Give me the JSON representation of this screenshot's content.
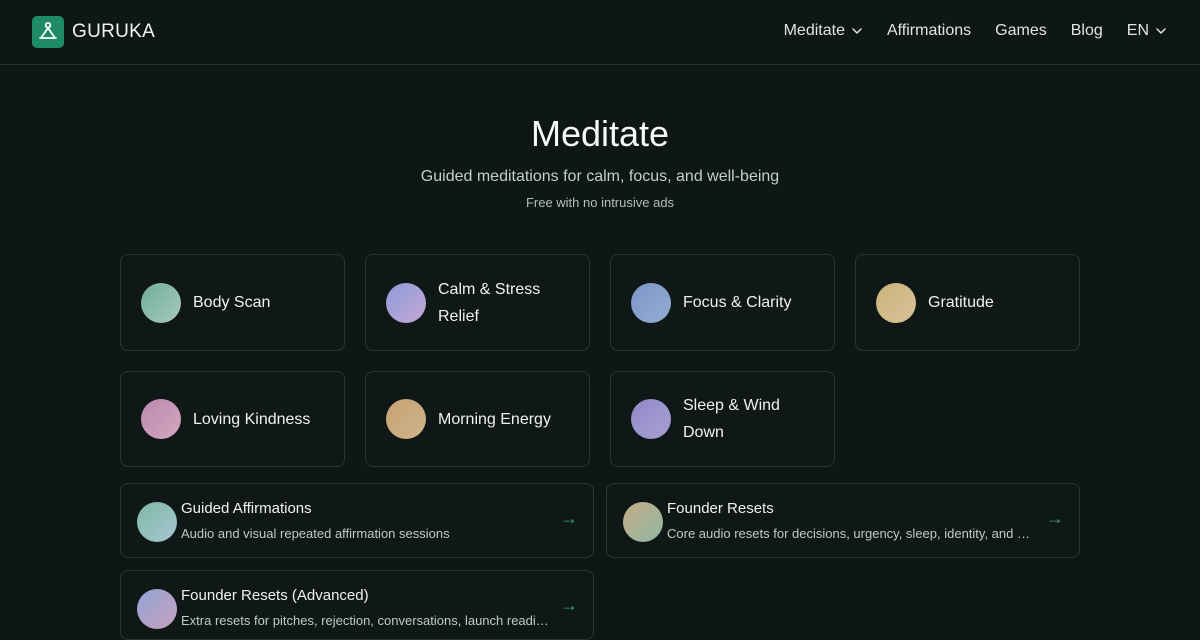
{
  "brand": {
    "name": "GURUKA",
    "accent": "#1f8a67"
  },
  "nav": {
    "meditate": "Meditate",
    "affirmations": "Affirmations",
    "games": "Games",
    "blog": "Blog",
    "language": "EN"
  },
  "hero": {
    "title": "Meditate",
    "subtitle": "Guided meditations for calm, focus, and well-being",
    "note": "Free with no intrusive ads"
  },
  "categories": [
    {
      "label": "Body Scan",
      "color_from": "#6fae9a",
      "color_to": "#a8c9bb"
    },
    {
      "label": "Calm & Stress Relief",
      "color_from": "#8d9ad8",
      "color_to": "#c6a9d6"
    },
    {
      "label": "Focus & Clarity",
      "color_from": "#7b97c9",
      "color_to": "#95abd2"
    },
    {
      "label": "Gratitude",
      "color_from": "#c9b27a",
      "color_to": "#d9c49a"
    },
    {
      "label": "Loving Kindness",
      "color_from": "#b98ab0",
      "color_to": "#d6a7bd"
    },
    {
      "label": "Morning Energy",
      "color_from": "#c5a274",
      "color_to": "#d0b48a"
    },
    {
      "label": "Sleep & Wind Down",
      "color_from": "#8f88c8",
      "color_to": "#a9a1d3"
    }
  ],
  "collections": [
    {
      "title": "Guided Affirmations",
      "description": "Audio and visual repeated affirmation sessions",
      "arrow": "→",
      "color_from": "#7fb7a4",
      "color_to": "#a7c7d2"
    },
    {
      "title": "Founder Resets",
      "description": "Core audio resets for decisions, urgency, sleep, identity, and more",
      "arrow": "→",
      "color_from": "#c6ad86",
      "color_to": "#8fb7a5"
    },
    {
      "title": "Founder Resets (Advanced)",
      "description": "Extra resets for pitches, rejection, conversations, launch readiness and more",
      "arrow": "→",
      "color_from": "#8fa5d6",
      "color_to": "#c9a0be"
    }
  ]
}
